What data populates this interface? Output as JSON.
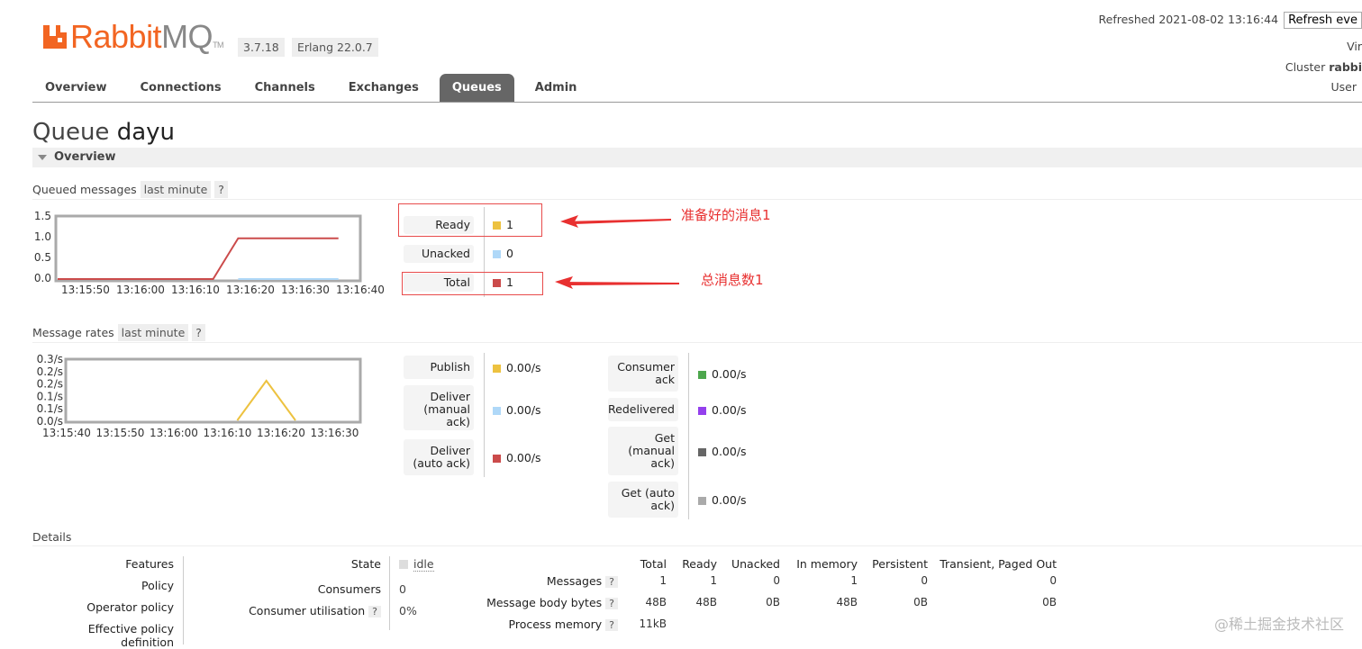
{
  "header": {
    "logo_text_1": "Rabbit",
    "logo_text_2": "MQ",
    "logo_tm": "TM",
    "version": "3.7.18",
    "erlang": "Erlang 22.0.7",
    "refreshed": "Refreshed 2021-08-02 13:16:44",
    "refresh_button": "Refresh eve",
    "virtual_host": "Vir",
    "cluster_label": "Cluster",
    "cluster_value": "rabbi",
    "user": "User"
  },
  "tabs": [
    "Overview",
    "Connections",
    "Channels",
    "Exchanges",
    "Queues",
    "Admin"
  ],
  "active_tab": "Queues",
  "page": {
    "title_prefix": "Queue",
    "title_name": "dayu",
    "section_label": "Overview"
  },
  "queued_messages": {
    "label": "Queued messages",
    "range": "last minute",
    "help": "?",
    "legend": [
      {
        "label": "Ready",
        "value": "1",
        "color": "#edc240"
      },
      {
        "label": "Unacked",
        "value": "0",
        "color": "#afd8f8"
      },
      {
        "label": "Total",
        "value": "1",
        "color": "#cb4b4b"
      }
    ],
    "annotations": [
      "准备好的消息1",
      "总消息数1"
    ]
  },
  "message_rates": {
    "label": "Message rates",
    "range": "last minute",
    "help": "?",
    "left": [
      {
        "label": "Publish",
        "value": "0.00/s",
        "color": "#edc240"
      },
      {
        "label": "Deliver (manual ack)",
        "value": "0.00/s",
        "color": "#afd8f8"
      },
      {
        "label": "Deliver (auto ack)",
        "value": "0.00/s",
        "color": "#cb4b4b"
      }
    ],
    "right": [
      {
        "label": "Consumer ack",
        "value": "0.00/s",
        "color": "#4da74d"
      },
      {
        "label": "Redelivered",
        "value": "0.00/s",
        "color": "#9440ed"
      },
      {
        "label": "Get (manual ack)",
        "value": "0.00/s",
        "color": "#666666"
      },
      {
        "label": "Get (auto ack)",
        "value": "0.00/s",
        "color": "#aaaaaa"
      }
    ]
  },
  "chart_data": [
    {
      "type": "line",
      "x": [
        "13:15:50",
        "13:16:00",
        "13:16:10",
        "13:16:20",
        "13:16:30",
        "13:16:40"
      ],
      "ylim": [
        0,
        1.5
      ],
      "yticks": [
        "1.5",
        "1.0",
        "0.5",
        "0.0"
      ],
      "series": [
        {
          "name": "Total",
          "color": "#cb4b4b",
          "points": [
            [
              0,
              0
            ],
            [
              31,
              0
            ],
            [
              36,
              1
            ],
            [
              56,
              1
            ]
          ]
        },
        {
          "name": "Unacked",
          "color": "#afd8f8",
          "points": [
            [
              36,
              0
            ],
            [
              56,
              0
            ]
          ]
        }
      ]
    },
    {
      "type": "line",
      "x": [
        "13:15:40",
        "13:15:50",
        "13:16:00",
        "13:16:10",
        "13:16:20",
        "13:16:30"
      ],
      "ylim": [
        0,
        0.3
      ],
      "yticks": [
        "0.3/s",
        "0.2/s",
        "0.2/s",
        "0.1/s",
        "0.1/s",
        "0.0/s"
      ],
      "series": [
        {
          "name": "Publish",
          "color": "#edc240",
          "points": [
            [
              35,
              0
            ],
            [
              41,
              0.2
            ],
            [
              47,
              0
            ]
          ]
        }
      ]
    }
  ],
  "details": {
    "label": "Details",
    "features": "Features",
    "policy": "Policy",
    "operator_policy": "Operator policy",
    "effective_policy": "Effective policy definition",
    "state_label": "State",
    "state_value": "idle",
    "consumers_label": "Consumers",
    "consumers_value": "0",
    "utilisation_label": "Consumer utilisation",
    "utilisation_value": "0%",
    "help": "?",
    "columns": [
      "Total",
      "Ready",
      "Unacked",
      "In memory",
      "Persistent",
      "Transient, Paged Out"
    ],
    "rows": [
      {
        "label": "Messages",
        "values": [
          "1",
          "1",
          "0",
          "1",
          "0",
          "0"
        ]
      },
      {
        "label": "Message body bytes",
        "values": [
          "48B",
          "48B",
          "0B",
          "48B",
          "0B",
          "0B"
        ]
      },
      {
        "label": "Process memory",
        "values": [
          "11kB",
          "",
          "",
          "",
          "",
          ""
        ]
      }
    ]
  },
  "watermark": "@稀土掘金技术社区"
}
